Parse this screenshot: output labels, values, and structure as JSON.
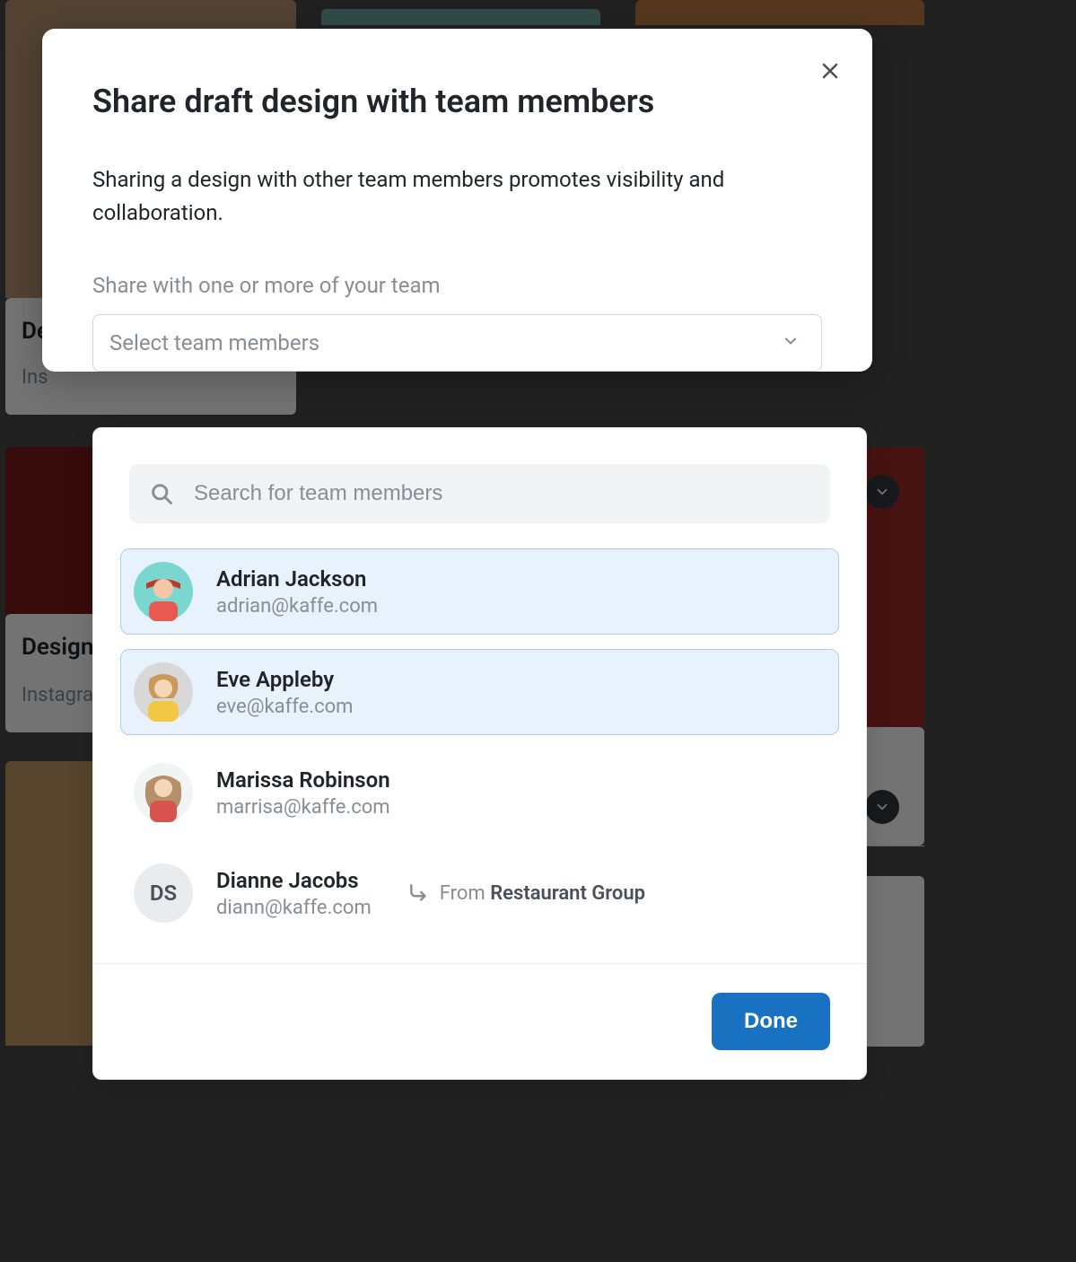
{
  "modal": {
    "title": "Share draft design with team members",
    "description": "Sharing a design with other team members promotes visibility and collaboration.",
    "section_label": "Share with one or more of your team",
    "select_placeholder": "Select team members",
    "search_placeholder": "Search for team members",
    "done_label": "Done"
  },
  "members": [
    {
      "name": "Adrian Jackson",
      "email": "adrian@kaffe.com",
      "selected": true,
      "avatar_type": "photo",
      "avatar_bg": "#7ad7cf"
    },
    {
      "name": "Eve Appleby",
      "email": "eve@kaffe.com",
      "selected": true,
      "avatar_type": "photo",
      "avatar_bg": "#f2d44a"
    },
    {
      "name": "Marissa Robinson",
      "email": "marrisa@kaffe.com",
      "selected": false,
      "avatar_type": "photo",
      "avatar_bg": "#d9534f"
    },
    {
      "name": "Dianne Jacobs",
      "email": "diann@kaffe.com",
      "selected": false,
      "avatar_type": "initials",
      "initials": "DS",
      "avatar_bg": "#e9ecef",
      "from_prefix": "From ",
      "from_group": "Restaurant Group"
    }
  ],
  "background": {
    "card1_title": "De",
    "card1_sub": "Ins",
    "card2_title": "Design",
    "card2_sub": "Instagra"
  }
}
